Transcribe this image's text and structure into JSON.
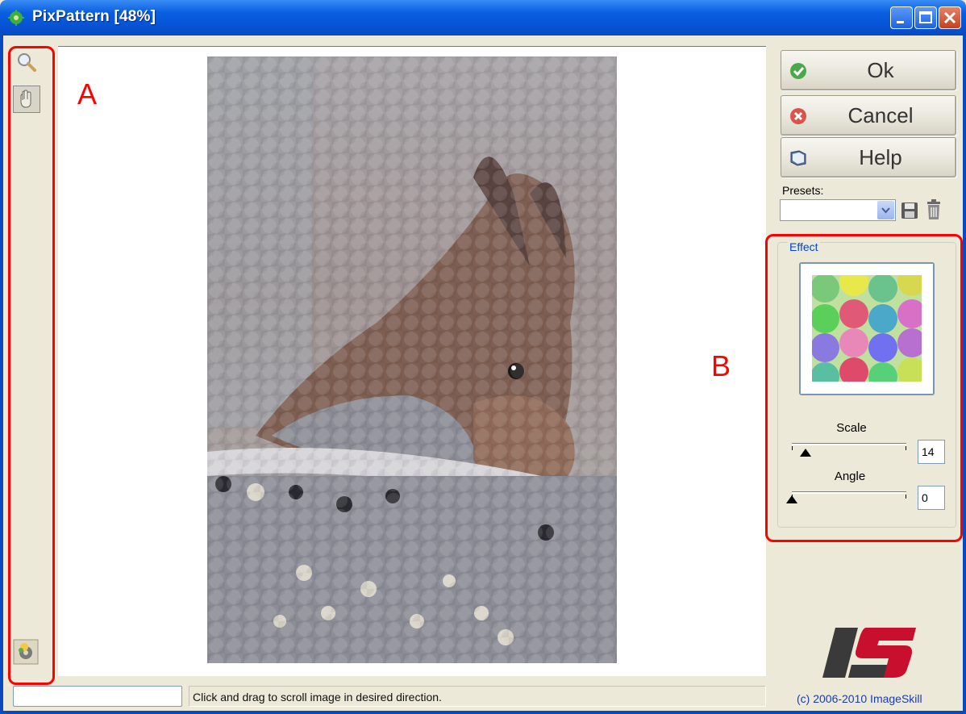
{
  "window": {
    "title": "PixPattern [48%]",
    "controls": [
      "minimize-icon",
      "maximize-icon",
      "close-icon"
    ]
  },
  "left_toolbar": {
    "tools": [
      {
        "name": "zoom",
        "icon": "magnifier-icon",
        "active": false
      },
      {
        "name": "hand",
        "icon": "hand-icon",
        "active": true
      }
    ],
    "bottom_tool": {
      "icon": "gear-settings-icon"
    }
  },
  "canvas": {
    "image_description_icon": "squirrel-photo"
  },
  "buttons": {
    "ok": "Ok",
    "cancel": "Cancel",
    "help": "Help"
  },
  "presets": {
    "label": "Presets:",
    "selected": "",
    "save_icon": "floppy-disk-icon",
    "delete_icon": "trash-icon"
  },
  "effect": {
    "group_label": "Effect",
    "scale": {
      "label": "Scale",
      "value": "14",
      "min": 0,
      "max": 100,
      "position_fraction": 0.12
    },
    "angle": {
      "label": "Angle",
      "value": "0",
      "min": 0,
      "max": 360,
      "position_fraction": 0.0
    }
  },
  "status": {
    "input_value": "",
    "message": "Click and drag to scroll image in desired direction."
  },
  "branding": {
    "logo": "IS",
    "copyright": "(c) 2006-2010 ImageSkill"
  },
  "annotations": {
    "a": "A",
    "b": "B",
    "color": "#ff0000"
  },
  "colors": {
    "titlebar": "#0654d6",
    "panel": "#ece9d8",
    "accent_link": "#0046d5",
    "logo_red": "#c8102e"
  }
}
